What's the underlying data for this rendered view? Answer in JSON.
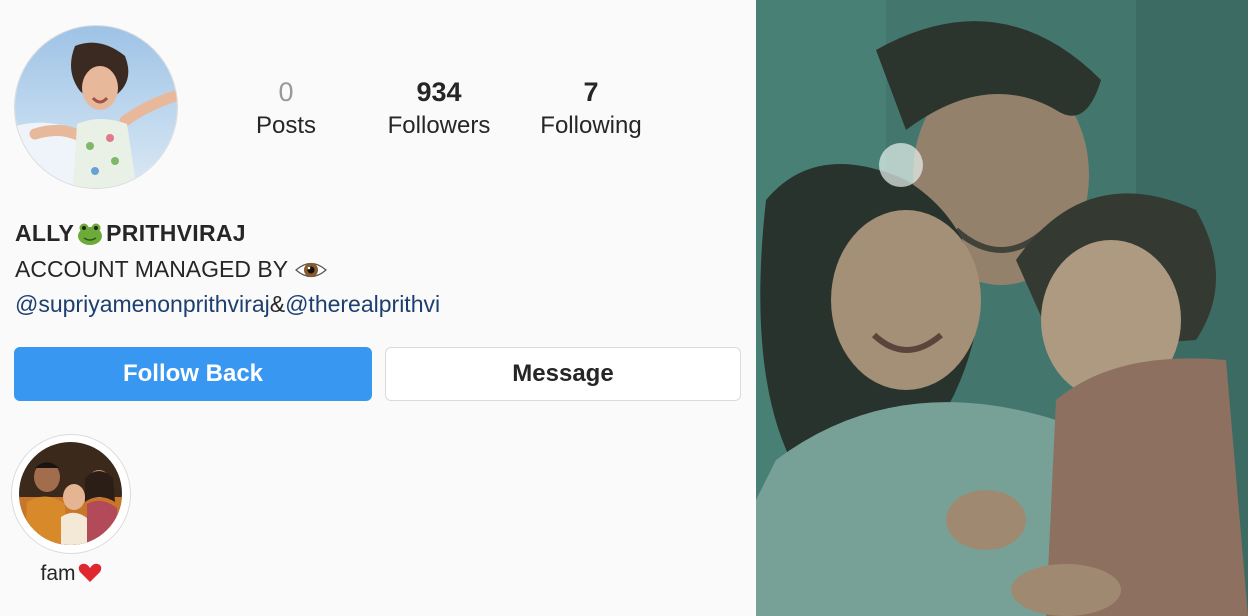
{
  "profile": {
    "stats": [
      {
        "value": "0",
        "label": "Posts"
      },
      {
        "value": "934",
        "label": "Followers"
      },
      {
        "value": "7",
        "label": "Following"
      }
    ],
    "name_left": "ALLY",
    "name_right": "PRITHVIRAJ",
    "name_emoji": "frog-emoji",
    "bio_line": "ACCOUNT MANAGED BY",
    "bio_emoji": "eye-emoji",
    "mention_1": "@supriyamenonprithviraj",
    "mention_sep": "&",
    "mention_2": "@therealprithvi"
  },
  "actions": {
    "follow_back_label": "Follow Back",
    "message_label": "Message"
  },
  "highlights": [
    {
      "label": "fam",
      "emoji": "red-heart-emoji"
    }
  ],
  "colors": {
    "primary_button": "#3897f0",
    "link": "#1c3f70",
    "text": "#262626",
    "muted": "#999999"
  }
}
